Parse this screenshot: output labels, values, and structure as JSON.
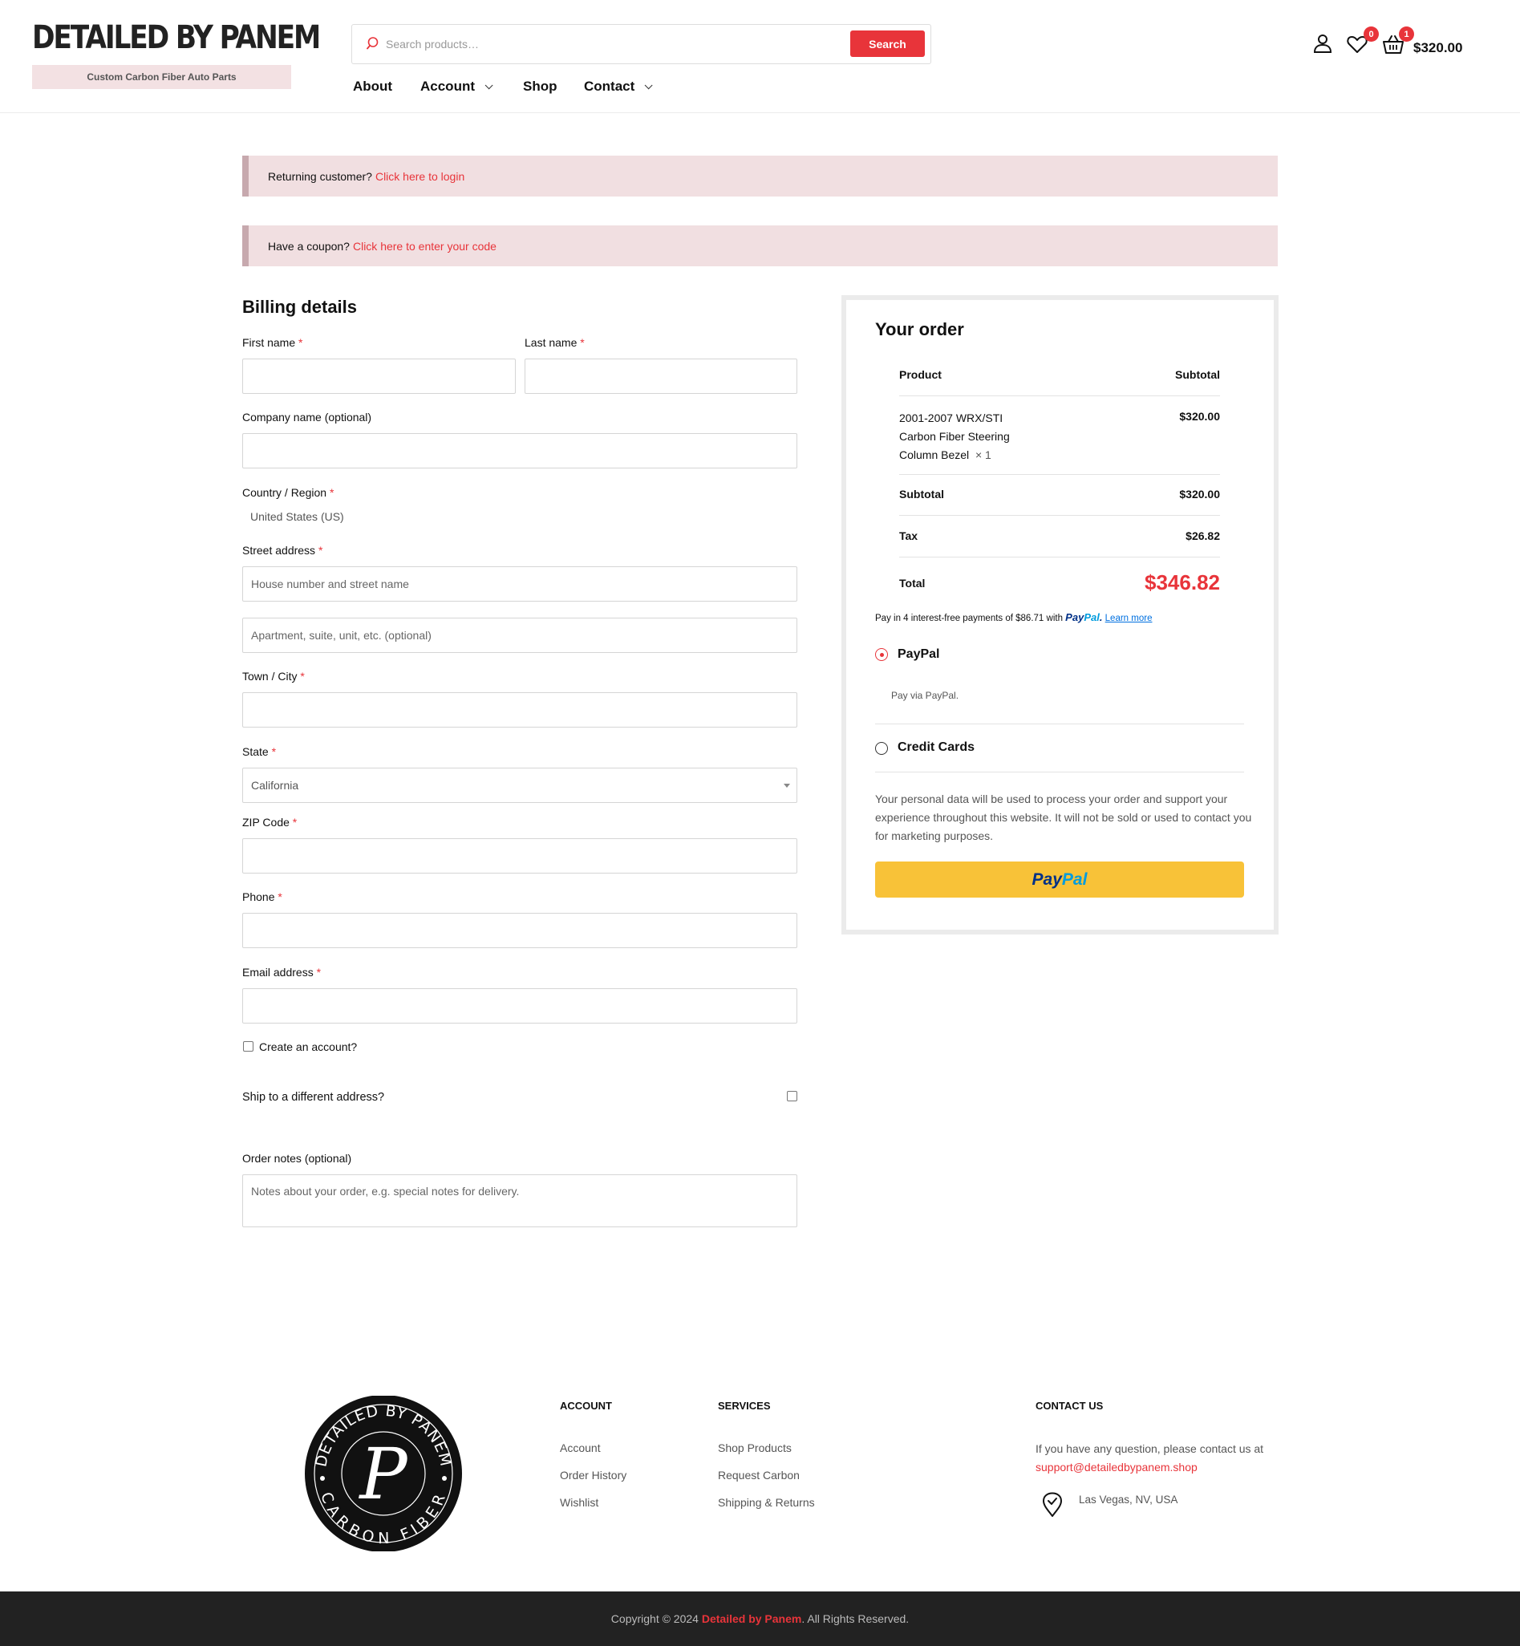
{
  "header": {
    "brand_title": "DETAILED BY PANEM",
    "brand_subtitle": "Custom Carbon Fiber Auto Parts",
    "search": {
      "placeholder": "Search products…",
      "button_label": "Search"
    },
    "nav": [
      {
        "label": "About",
        "has_dropdown": false
      },
      {
        "label": "Account",
        "has_dropdown": true
      },
      {
        "label": "Shop",
        "has_dropdown": false
      },
      {
        "label": "Contact",
        "has_dropdown": true
      }
    ],
    "icons": {
      "account": "user-icon",
      "wishlist": "heart-icon",
      "cart": "basket-icon"
    },
    "wishlist_count": "0",
    "cart_count": "1",
    "cart_total": "$320.00"
  },
  "notices": {
    "login": {
      "text": "Returning customer?",
      "link": "Click here to login"
    },
    "coupon": {
      "text": "Have a coupon?",
      "link": "Click here to enter your code"
    }
  },
  "billing": {
    "title": "Billing details",
    "required_mark": "*",
    "first_name_label": "First name",
    "last_name_label": "Last name",
    "company_label": "Company name (optional)",
    "country_label": "Country / Region",
    "country_value": "United States (US)",
    "street_label": "Street address",
    "street_placeholder": "House number and street name",
    "street2_placeholder": "Apartment, suite, unit, etc. (optional)",
    "city_label": "Town / City",
    "state_label": "State",
    "state_value": "California",
    "zip_label": "ZIP Code",
    "phone_label": "Phone",
    "email_label": "Email address",
    "create_account_label": "Create an account?",
    "ship_different_label": "Ship to a different address?",
    "order_notes_label": "Order notes (optional)",
    "order_notes_placeholder": "Notes about your order, e.g. special notes for delivery."
  },
  "order": {
    "title": "Your order",
    "col_product": "Product",
    "col_subtotal": "Subtotal",
    "item_name_lines": [
      "2001-2007 WRX/STI",
      "Carbon Fiber Steering",
      "Column Bezel"
    ],
    "item_qty": "× 1",
    "item_price": "$320.00",
    "subtotal_label": "Subtotal",
    "subtotal_value": "$320.00",
    "tax_label": "Tax",
    "tax_value": "$26.82",
    "total_label": "Total",
    "total_value": "$346.82",
    "pay_later_text": "Pay in 4 interest-free payments of $86.71 with",
    "pay_later_logo_a": "Pay",
    "pay_later_logo_b": "Pal",
    "pay_later_link": "Learn more",
    "methods": [
      {
        "label": "PayPal",
        "selected": true,
        "description": "Pay via PayPal."
      },
      {
        "label": "Credit Cards",
        "selected": false
      }
    ],
    "privacy_text": "Your personal data will be used to process your order and support your experience throughout this website. It will not be sold or used to contact you for marketing purposes.",
    "paypal_button_a": "Pay",
    "paypal_button_b": "Pal"
  },
  "footer": {
    "logo_text_top": "DETAILED BY PANEM",
    "logo_text_bottom": "CARBON FIBER",
    "logo_letter": "P",
    "account_title": "ACCOUNT",
    "account_links": [
      "Account",
      "Order History",
      "Wishlist"
    ],
    "services_title": "SERVICES",
    "services_links": [
      "Shop Products",
      "Request Carbon",
      "Shipping & Returns"
    ],
    "contact_title": "CONTACT US",
    "contact_text": "If you have any question, please contact us at",
    "contact_email": "support@detailedbypanem.shop",
    "location": "Las Vegas, NV, USA",
    "copyright_pre": "Copyright © 2024",
    "copyright_brand": "Detailed by Panem",
    "copyright_post": ". All Rights Reserved."
  },
  "colors": {
    "accent": "#e8343a",
    "notice_bg": "#f1dfe1",
    "paypal_yellow": "#f8c238",
    "footer_bar": "#222222"
  }
}
